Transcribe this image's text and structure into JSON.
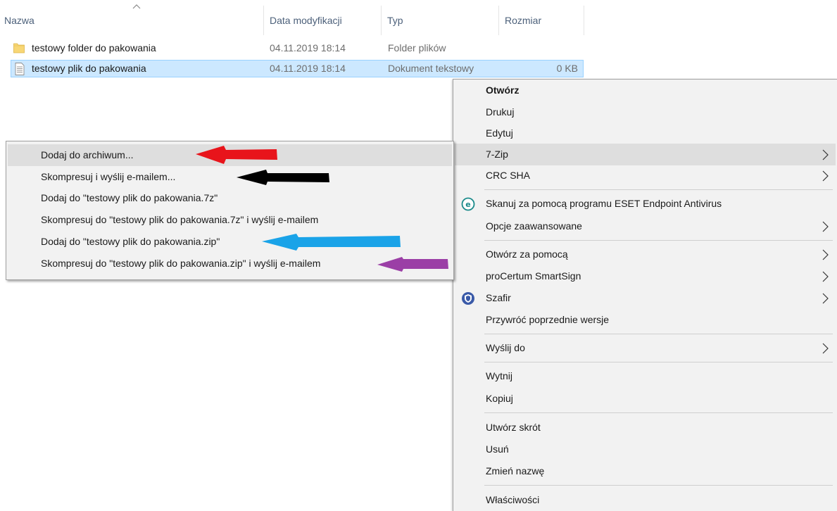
{
  "columns": {
    "name": "Nazwa",
    "modified": "Data modyfikacji",
    "type": "Typ",
    "size": "Rozmiar"
  },
  "files": [
    {
      "icon": "folder-icon",
      "name": "testowy folder do pakowania",
      "modified": "04.11.2019 18:14",
      "type": "Folder plików",
      "size": ""
    },
    {
      "icon": "text-file-icon",
      "name": "testowy plik do pakowania",
      "modified": "04.11.2019 18:14",
      "type": "Dokument tekstowy",
      "size": "0 KB"
    }
  ],
  "context_menu": {
    "items": [
      "Otwórz",
      "Drukuj",
      "Edytuj",
      "7-Zip",
      "CRC SHA",
      "Skanuj za pomocą programu ESET Endpoint Antivirus",
      "Opcje zaawansowane",
      "Otwórz za pomocą",
      "proCertum SmartSign",
      "Szafir",
      "Przywróć poprzednie wersje",
      "Wyślij do",
      "Wytnij",
      "Kopiuj",
      "Utwórz skrót",
      "Usuń",
      "Zmień nazwę",
      "Właściwości"
    ]
  },
  "zip_submenu": {
    "items": [
      "Dodaj do archiwum...",
      "Skompresuj i wyślij e-mailem...",
      "Dodaj do \"testowy plik do pakowania.7z\"",
      "Skompresuj do \"testowy plik do pakowania.7z\" i wyślij e-mailem",
      "Dodaj do \"testowy plik do pakowania.zip\"",
      "Skompresuj do \"testowy plik do pakowania.zip\" i wyślij e-mailem"
    ]
  },
  "annotation_colors": {
    "red": "#e8141b",
    "black": "#000000",
    "blue": "#1aa3e8",
    "purple": "#9b3fa6"
  },
  "colors": {
    "selection": "#cce8ff",
    "menu_bg": "#f2f2f2",
    "menu_hover": "#dedede",
    "header_text": "#4c607a"
  }
}
